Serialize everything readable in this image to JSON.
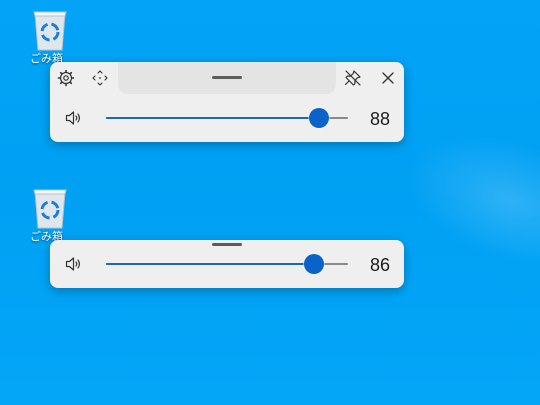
{
  "desktop": {
    "recycle_bin_label": "ごみ箱",
    "background_color": "#00a2f4"
  },
  "volume_panel_expanded": {
    "value": "88",
    "level_percent": 88,
    "icons": [
      "settings-gear-icon",
      "move-arrows-icon",
      "unpin-icon",
      "close-icon",
      "speaker-icon"
    ]
  },
  "volume_panel_compact": {
    "value": "86",
    "level_percent": 86,
    "icons": [
      "speaker-icon"
    ]
  },
  "colors": {
    "accent": "#0a63c9",
    "panel_bg": "#efefef",
    "track": "#8a8a8a"
  }
}
